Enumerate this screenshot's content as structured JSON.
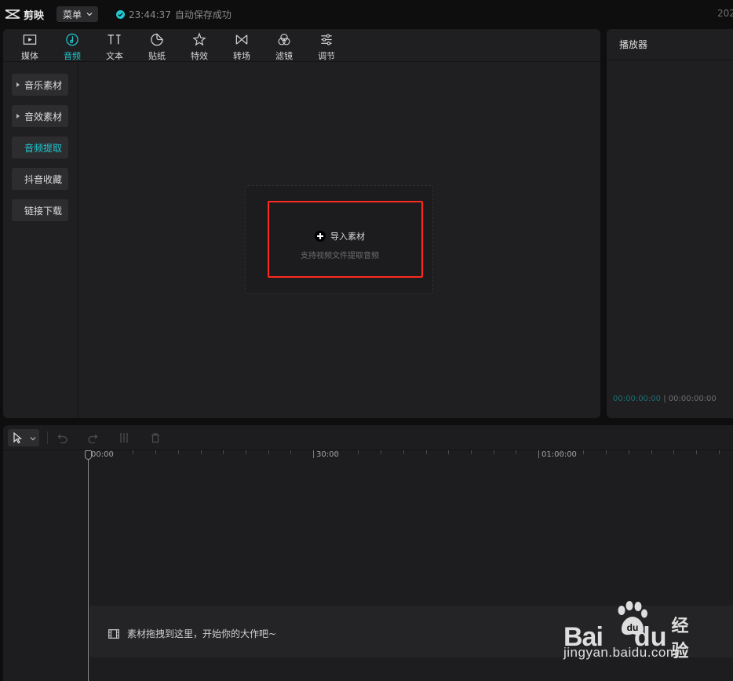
{
  "app": {
    "name": "剪映"
  },
  "topbar": {
    "menu_label": "菜单",
    "save_time": "23:44:37",
    "save_text": "自动保存成功",
    "year": "202"
  },
  "toolbar": {
    "tabs": [
      {
        "label": "媒体",
        "icon": "media-icon"
      },
      {
        "label": "音频",
        "icon": "audio-icon",
        "active": true
      },
      {
        "label": "文本",
        "icon": "text-icon"
      },
      {
        "label": "贴纸",
        "icon": "sticker-icon"
      },
      {
        "label": "特效",
        "icon": "effects-icon"
      },
      {
        "label": "转场",
        "icon": "transition-icon"
      },
      {
        "label": "滤镜",
        "icon": "filter-icon"
      },
      {
        "label": "调节",
        "icon": "adjust-icon"
      }
    ]
  },
  "categories": [
    {
      "label": "音乐素材",
      "expandable": true
    },
    {
      "label": "音效素材",
      "expandable": true
    },
    {
      "label": "音频提取",
      "active": true
    },
    {
      "label": "抖音收藏"
    },
    {
      "label": "链接下载"
    }
  ],
  "import": {
    "label": "导入素材",
    "hint": "支持视频文件提取音频"
  },
  "player": {
    "title": "播放器",
    "current_time": "00:00:00:00",
    "total_time": "00:00:00:00"
  },
  "timeline": {
    "ruler": [
      "00:00",
      "30:00",
      "01:00:00"
    ],
    "hint": "素材拖拽到这里，开始你的大作吧~"
  },
  "watermark": {
    "brand_left": "Bai",
    "brand_right": "du",
    "suffix": "经验",
    "url": "jingyan.baidu.com"
  },
  "colors": {
    "accent": "#1ec8cf",
    "highlight": "#ff2a1f",
    "panel": "#1f1f21",
    "background": "#0e0e0f"
  }
}
